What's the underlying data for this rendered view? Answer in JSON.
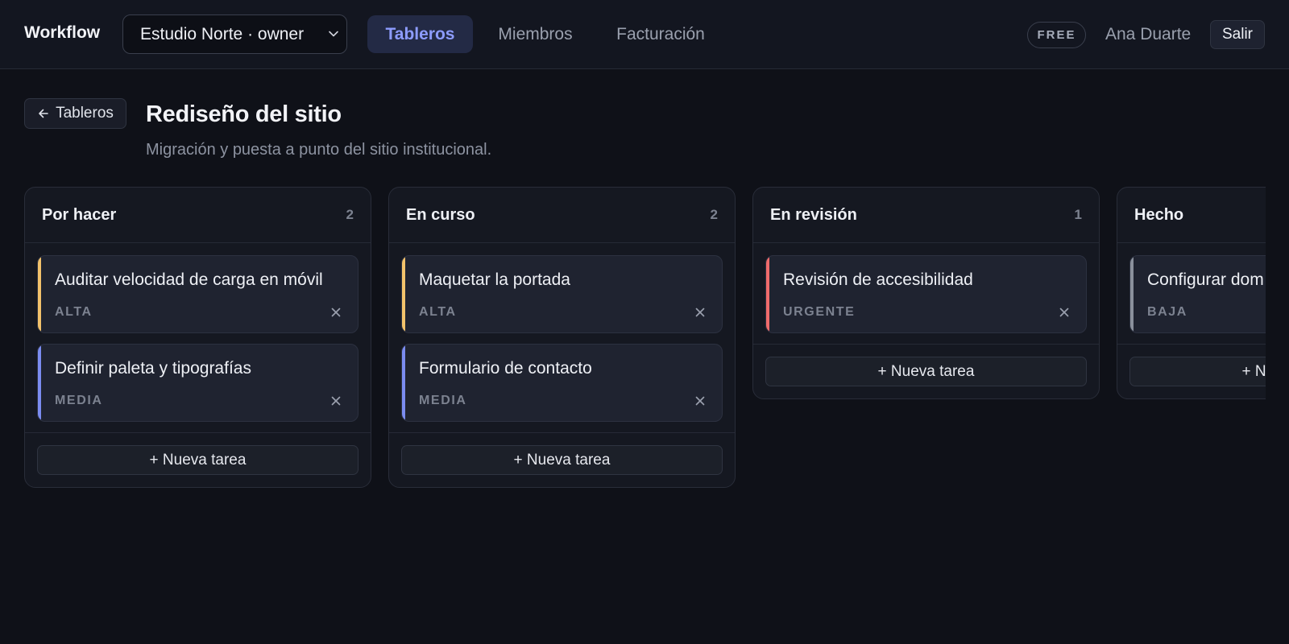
{
  "topbar": {
    "brand": "Workflow",
    "org_select": "Estudio Norte · owner",
    "tabs": [
      {
        "label": "Tableros",
        "active": true
      },
      {
        "label": "Miembros",
        "active": false
      },
      {
        "label": "Facturación",
        "active": false
      }
    ],
    "plan_badge": "FREE",
    "user_name": "Ana Duarte",
    "logout_label": "Salir"
  },
  "board": {
    "back_label": "Tableros",
    "title": "Rediseño del sitio",
    "description": "Migración y puesta a punto del sitio institucional.",
    "add_task_label": "+ Nueva tarea",
    "columns": [
      {
        "title": "Por hacer",
        "count": "2",
        "cards": [
          {
            "title": "Auditar velocidad de carga en móvil",
            "priority": "ALTA"
          },
          {
            "title": "Definir paleta y tipografías",
            "priority": "MEDIA"
          }
        ]
      },
      {
        "title": "En curso",
        "count": "2",
        "cards": [
          {
            "title": "Maquetar la portada",
            "priority": "ALTA"
          },
          {
            "title": "Formulario de contacto",
            "priority": "MEDIA"
          }
        ]
      },
      {
        "title": "En revisión",
        "count": "1",
        "cards": [
          {
            "title": "Revisión de accesibilidad",
            "priority": "URGENTE"
          }
        ]
      },
      {
        "title": "Hecho",
        "count": "",
        "cards": [
          {
            "title": "Configurar dom",
            "priority": "BAJA"
          }
        ]
      }
    ]
  },
  "colors": {
    "accent": "#8d9cff",
    "priority_alta": "#f2c26b",
    "priority_media": "#7b8cf0",
    "priority_urgente": "#ef6b6b",
    "priority_baja": "#8a909c"
  },
  "icons": {
    "back": "arrow-left-icon",
    "org_select": "chevron-down-icon",
    "card_remove": "close-icon"
  }
}
